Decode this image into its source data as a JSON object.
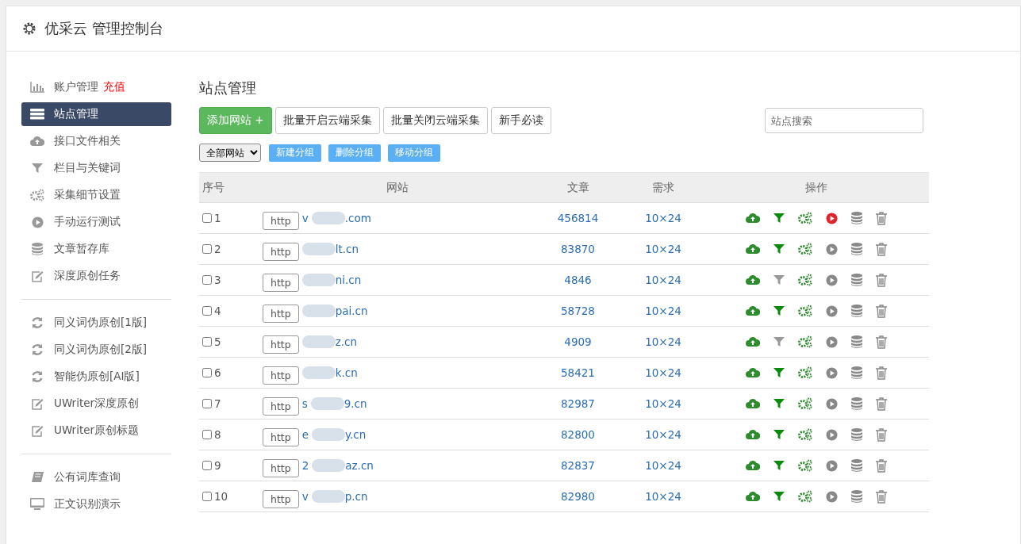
{
  "header": {
    "title": "优采云 管理控制台"
  },
  "sidebar": {
    "groups": [
      {
        "items": [
          {
            "kind": "chart",
            "label": "账户管理",
            "badge": "充值",
            "selected": false
          },
          {
            "kind": "server",
            "label": "站点管理",
            "selected": true
          },
          {
            "kind": "cloud",
            "label": "接口文件相关",
            "selected": false
          },
          {
            "kind": "filter",
            "label": "栏目与关键词",
            "selected": false
          },
          {
            "kind": "gears",
            "label": "采集细节设置",
            "selected": false
          },
          {
            "kind": "play",
            "label": "手动运行测试",
            "selected": false
          },
          {
            "kind": "database",
            "label": "文章暂存库",
            "selected": false
          },
          {
            "kind": "edit",
            "label": "深度原创任务",
            "selected": false
          }
        ]
      },
      {
        "items": [
          {
            "kind": "refresh",
            "label": "同义词伪原创[1版]",
            "selected": false
          },
          {
            "kind": "refresh",
            "label": "同义词伪原创[2版]",
            "selected": false
          },
          {
            "kind": "refresh",
            "label": "智能伪原创[AI版]",
            "selected": false
          },
          {
            "kind": "edit",
            "label": "UWriter深度原创",
            "selected": false
          },
          {
            "kind": "edit",
            "label": "UWriter原创标题",
            "selected": false
          }
        ]
      },
      {
        "items": [
          {
            "kind": "book",
            "label": "公有词库查询",
            "selected": false
          },
          {
            "kind": "monitor",
            "label": "正文识别演示",
            "selected": false
          }
        ]
      }
    ]
  },
  "main": {
    "title": "站点管理",
    "toolbar": [
      {
        "kind": "primary",
        "label": "添加网站 +"
      },
      {
        "kind": "default",
        "label": "批量开启云端采集"
      },
      {
        "kind": "default",
        "label": "批量关闭云端采集"
      },
      {
        "kind": "default",
        "label": "新手必读"
      }
    ],
    "search": {
      "placeholder": "站点搜索"
    },
    "group_select": {
      "value": "全部网站"
    },
    "group_buttons": [
      "新建分组",
      "删除分组",
      "移动分组"
    ],
    "table": {
      "columns": [
        "序号",
        "网站",
        "文章",
        "需求",
        "操作"
      ],
      "rows": [
        {
          "checked": false,
          "index": "1",
          "scheme": "http",
          "domain_start": "v",
          "domain_end": ".com",
          "articles": "456814",
          "demand": "10×24",
          "filter_enabled": true,
          "running": true
        },
        {
          "checked": false,
          "index": "2",
          "scheme": "http",
          "domain_end": "lt.cn",
          "articles": "83870",
          "demand": "10×24",
          "filter_enabled": true,
          "running": false
        },
        {
          "checked": false,
          "index": "3",
          "scheme": "http",
          "domain_end": "ni.cn",
          "articles": "4846",
          "demand": "10×24",
          "filter_enabled": false,
          "running": false
        },
        {
          "checked": false,
          "index": "4",
          "scheme": "http",
          "domain_end": "pai.cn",
          "articles": "58728",
          "demand": "10×24",
          "filter_enabled": true,
          "running": false
        },
        {
          "checked": false,
          "index": "5",
          "scheme": "http",
          "domain_end": "z.cn",
          "articles": "4909",
          "demand": "10×24",
          "filter_enabled": false,
          "running": false
        },
        {
          "checked": false,
          "index": "6",
          "scheme": "http",
          "domain_end": "k.cn",
          "articles": "58421",
          "demand": "10×24",
          "filter_enabled": true,
          "running": false
        },
        {
          "checked": false,
          "index": "7",
          "scheme": "http",
          "domain_start": "s",
          "domain_end": "9.cn",
          "articles": "82987",
          "demand": "10×24",
          "filter_enabled": true,
          "running": false
        },
        {
          "checked": false,
          "index": "8",
          "scheme": "http",
          "domain_start": "e",
          "domain_end": "y.cn",
          "articles": "82800",
          "demand": "10×24",
          "filter_enabled": true,
          "running": false
        },
        {
          "checked": false,
          "index": "9",
          "scheme": "http",
          "domain_start": "2",
          "domain_end": "az.cn",
          "articles": "82837",
          "demand": "10×24",
          "filter_enabled": true,
          "running": false
        },
        {
          "checked": false,
          "index": "10",
          "scheme": "http",
          "domain_start": "v",
          "domain_end": "p.cn",
          "articles": "82980",
          "demand": "10×24",
          "filter_enabled": true,
          "running": false
        }
      ]
    }
  }
}
